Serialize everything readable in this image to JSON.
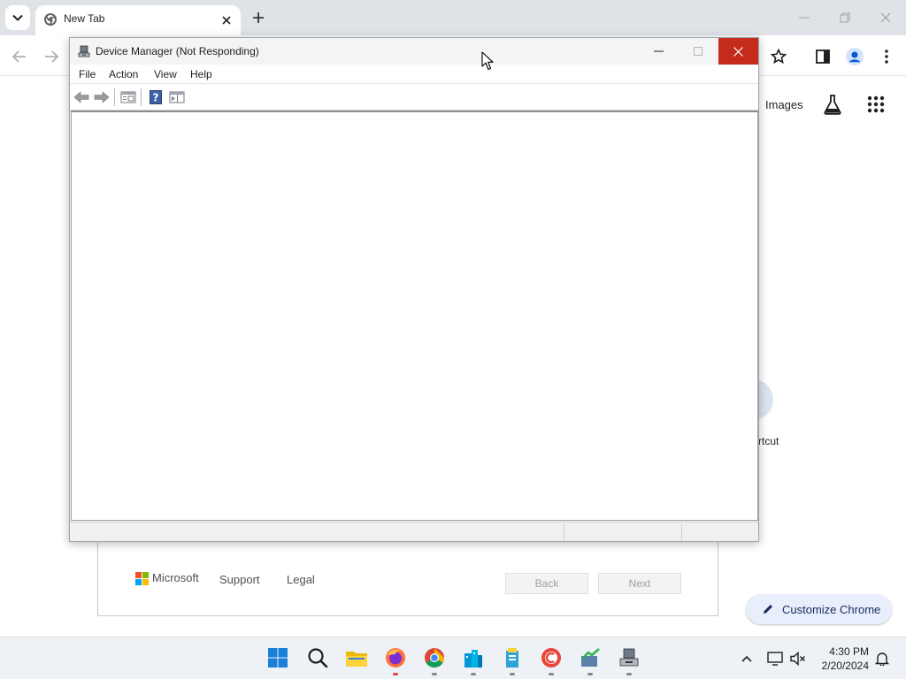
{
  "browser": {
    "tab_title": "New Tab",
    "ntp": {
      "images_link": "Images",
      "shortcut_label_partial": "rtcut",
      "customize_label": "Customize Chrome"
    }
  },
  "background_dialog": {
    "brand": "Microsoft",
    "links": [
      "Support",
      "Legal"
    ],
    "back_label": "Back",
    "next_label": "Next",
    "logo_colors": [
      "#f25022",
      "#7fba00",
      "#00a4ef",
      "#ffb900"
    ]
  },
  "device_manager": {
    "title": "Device Manager (Not Responding)",
    "menu": [
      "File",
      "Action",
      "View",
      "Help"
    ],
    "toolbar_icons": [
      "back-arrow-icon",
      "forward-arrow-icon",
      "properties-icon",
      "help-icon",
      "show-hide-console-tree-icon"
    ],
    "close_color": "#c42b1c"
  },
  "taskbar": {
    "apps": [
      "windows-start-icon",
      "search-icon",
      "file-explorer-icon",
      "firefox-icon",
      "chrome-icon",
      "app-icon-blue-buildings",
      "app-icon-book-stack",
      "app-icon-red-circle",
      "app-icon-green-chart",
      "app-icon-device-manager"
    ],
    "time": "4:30 PM",
    "date": "2/20/2024"
  }
}
